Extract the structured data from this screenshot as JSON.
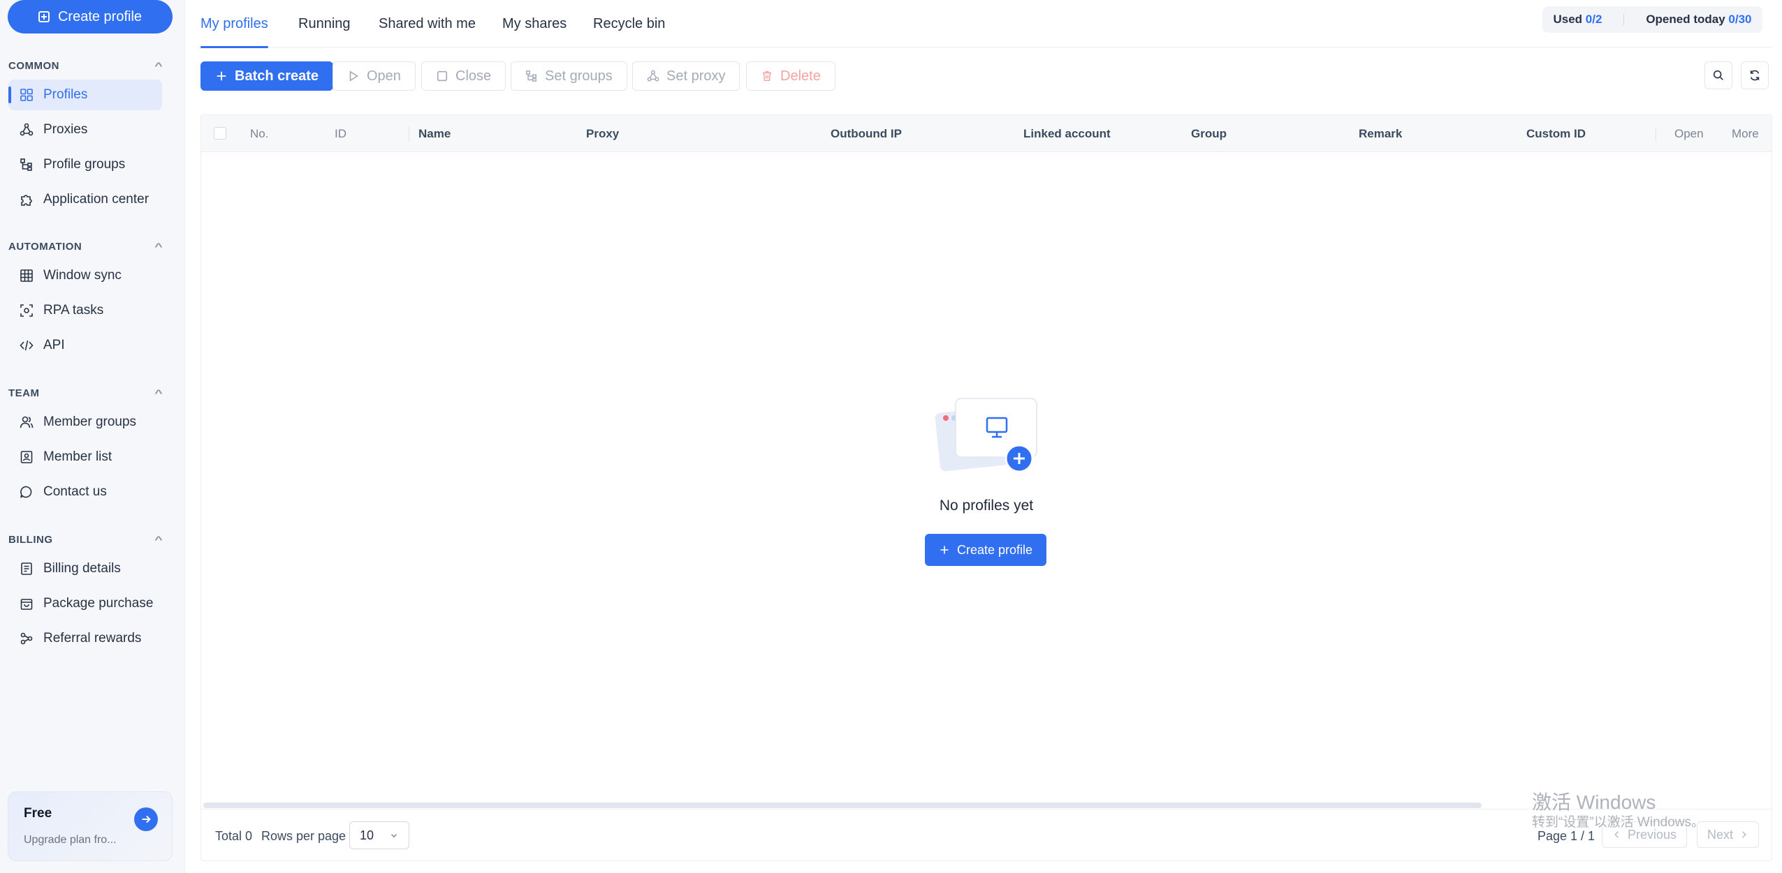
{
  "sidebar": {
    "create_label": "Create profile",
    "sections": {
      "common": "COMMON",
      "automation": "AUTOMATION",
      "team": "TEAM",
      "billing": "BILLING"
    },
    "items": {
      "profiles": "Profiles",
      "proxies": "Proxies",
      "profile_groups": "Profile groups",
      "application_center": "Application center",
      "window_sync": "Window sync",
      "rpa_tasks": "RPA tasks",
      "api": "API",
      "member_groups": "Member groups",
      "member_list": "Member list",
      "contact_us": "Contact us",
      "billing_details": "Billing details",
      "package_purchase": "Package purchase",
      "referral_rewards": "Referral rewards"
    },
    "plan": {
      "title": "Free",
      "subtitle": "Upgrade plan fro..."
    }
  },
  "tabs": {
    "my_profiles": "My profiles",
    "running": "Running",
    "shared_with_me": "Shared with me",
    "my_shares": "My shares",
    "recycle_bin": "Recycle bin"
  },
  "usage": {
    "used_label": "Used",
    "used_value": "0/2",
    "opened_label": "Opened today",
    "opened_value": "0/30"
  },
  "toolbar": {
    "batch_create": "Batch create",
    "open": "Open",
    "close": "Close",
    "set_groups": "Set groups",
    "set_proxy": "Set proxy",
    "delete": "Delete"
  },
  "table": {
    "columns": {
      "no": "No.",
      "id": "ID",
      "name": "Name",
      "proxy": "Proxy",
      "outbound_ip": "Outbound IP",
      "linked_account": "Linked account",
      "group": "Group",
      "remark": "Remark",
      "custom_id": "Custom ID",
      "open": "Open",
      "more": "More"
    },
    "empty_text": "No profiles yet",
    "empty_create": "Create profile"
  },
  "footer": {
    "total": "Total 0",
    "rows_per_page_label": "Rows per page",
    "rows_per_page_value": "10",
    "page": "Page 1 / 1",
    "previous": "Previous",
    "next": "Next"
  },
  "watermark": {
    "line1": "激活 Windows",
    "line2": "转到“设置”以激活 Windows。"
  },
  "colors": {
    "accent": "#2f6ff0",
    "sidebar_bg": "#f6f7fa",
    "active_bg": "#e3eafb"
  }
}
